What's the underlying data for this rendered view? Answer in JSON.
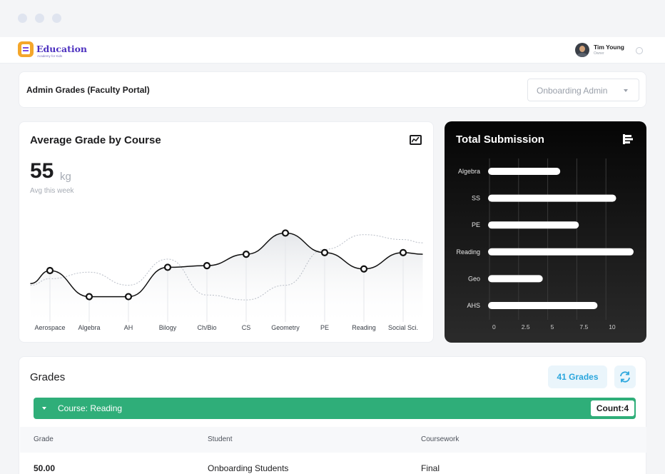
{
  "brand": {
    "name": "Education",
    "tagline": "Academy for Kids"
  },
  "user": {
    "name": "Tim Young",
    "role": "Owner"
  },
  "portal": {
    "title": "Admin Grades (Faculty Portal)",
    "selector_value": "Onboarding Admin"
  },
  "avg_card": {
    "title": "Average Grade by Course",
    "value": "55",
    "unit": "kg",
    "subtitle": "Avg this week"
  },
  "submission_card": {
    "title": "Total Submission"
  },
  "grades": {
    "title": "Grades",
    "count_label": "41 Grades",
    "group_label": "Course: Reading",
    "group_count": "Count:4",
    "columns": [
      "Grade",
      "Student",
      "Coursework"
    ],
    "rows": [
      {
        "grade": "50.00",
        "student": "Onboarding Students",
        "coursework": "Final"
      }
    ]
  },
  "colors": {
    "accent_green": "#2fae79",
    "accent_blue": "#2aa6dd",
    "brand_purple": "#4b2fbf"
  },
  "chart_data": [
    {
      "type": "line",
      "title": "Average Grade by Course",
      "categories": [
        "Aerospace",
        "Algebra",
        "AH",
        "Bilogy",
        "Ch/Bio",
        "CS",
        "Geometry",
        "PE",
        "Reading",
        "Social Sci."
      ],
      "series": [
        {
          "values": [
            45,
            29,
            29,
            47,
            48,
            55,
            68,
            56,
            46,
            56
          ]
        },
        {
          "values": [
            40,
            44,
            36,
            52,
            30,
            27,
            36,
            58,
            67,
            64
          ]
        }
      ],
      "ylim": [
        10,
        80
      ],
      "grid": false
    },
    {
      "type": "bar",
      "orientation": "horizontal",
      "title": "Total Submission",
      "categories": [
        "Algebra",
        "SS",
        "PE",
        "Reading",
        "Geo",
        "AHS"
      ],
      "values": [
        6.2,
        11,
        7.8,
        12.5,
        4.7,
        9.4
      ],
      "x_ticks": [
        "0",
        "2.5",
        "5",
        "7.5",
        "10"
      ],
      "xlim": [
        0,
        12.5
      ],
      "grid": true
    }
  ]
}
